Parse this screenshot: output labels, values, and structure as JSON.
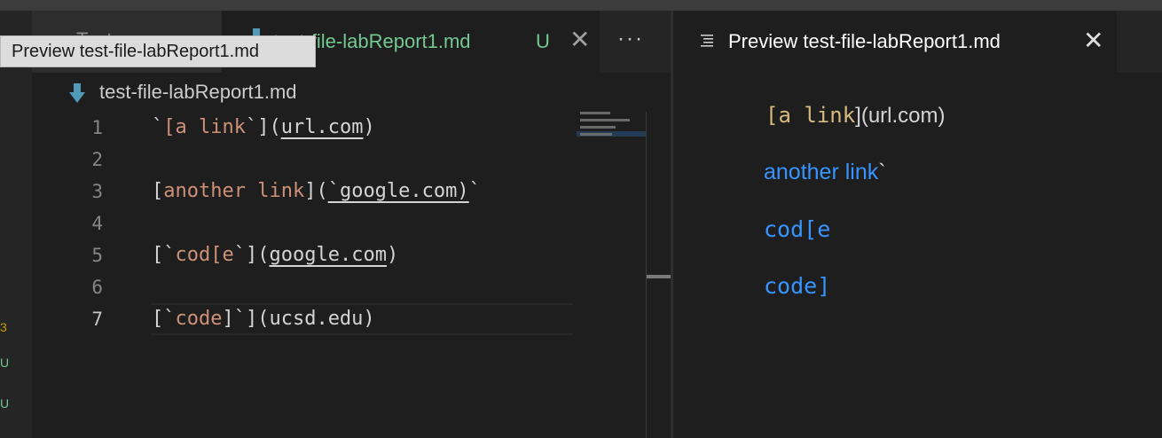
{
  "colors": {
    "background": "#1e1e1e",
    "untracked_green": "#73c991",
    "link_blue": "#3794ff",
    "string_orange": "#ce9178",
    "inline_code_gold": "#d7ba7d"
  },
  "left_group": {
    "inactive_tab": {
      "label": "Test"
    },
    "active_tab": {
      "icon": "markdown-file-icon",
      "label": "test-file-labReport1.md",
      "badge": "U",
      "close_icon": "close-icon"
    },
    "more_actions": "···",
    "tooltip": "Preview test-file-labReport1.md",
    "breadcrumb": {
      "icon": "markdown-file-icon",
      "label": "test-file-labReport1.md"
    },
    "line_numbers": [
      "1",
      "2",
      "3",
      "4",
      "5",
      "6",
      "7"
    ],
    "current_line": 7,
    "lines": {
      "l1": {
        "p1": "`",
        "p2": "[a link",
        "p3": "`",
        "p4": "](",
        "p5": "url.com",
        "p6": ")"
      },
      "l3": {
        "p1": "[",
        "p2": "another link",
        "p3": "](",
        "p4": "`google.com)",
        "p5": "`"
      },
      "l5": {
        "p1": "[`",
        "p2": "cod[e",
        "p3": "`](",
        "p4": "google.com",
        "p5": ")"
      },
      "l7": {
        "p1": "[`",
        "p2": "code",
        "p3": "]`](ucsd.edu)"
      }
    }
  },
  "right_group": {
    "tab": {
      "icon": "preview-icon",
      "label": "Preview test-file-labReport1.md",
      "close_icon": "close-icon"
    },
    "preview": {
      "line1_code": "[a link",
      "line1_text": "](url.com)",
      "link2_text": "another link",
      "link2_tick": "`",
      "link3_text": "cod[e",
      "link4_text": "code]"
    }
  }
}
